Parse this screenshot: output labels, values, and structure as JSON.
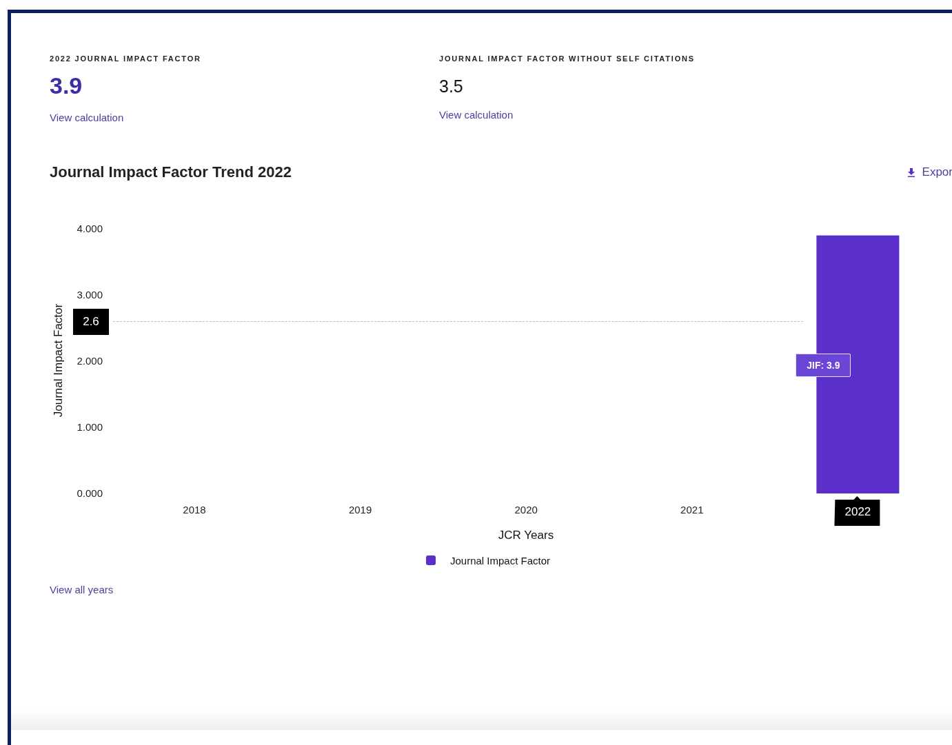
{
  "metrics": [
    {
      "label": "2022 JOURNAL IMPACT FACTOR",
      "value": "3.9",
      "link": "View calculation",
      "highlight": true
    },
    {
      "label": "JOURNAL IMPACT FACTOR WITHOUT SELF CITATIONS",
      "value": "3.5",
      "link": "View calculation",
      "highlight": false
    }
  ],
  "trend": {
    "title": "Journal Impact Factor Trend 2022",
    "export": "Expor",
    "chart_data": {
      "type": "bar",
      "xlabel": "JCR Years",
      "ylabel": "Journal Impact Factor",
      "categories": [
        "2018",
        "2019",
        "2020",
        "2021",
        "2022"
      ],
      "series": [
        {
          "name": "Journal Impact Factor",
          "color": "#5b2fc9",
          "values": [
            null,
            null,
            null,
            null,
            3.9
          ]
        }
      ],
      "ylim": [
        0,
        4
      ],
      "yticks": [
        {
          "value": 0,
          "label": "0.000"
        },
        {
          "value": 1,
          "label": "1.000"
        },
        {
          "value": 2,
          "label": "2.000"
        },
        {
          "value": 3,
          "label": "3.000"
        },
        {
          "value": 4,
          "label": "4.000"
        }
      ]
    },
    "average_label": "2.6",
    "selected_years": [
      false,
      false,
      false,
      false,
      true
    ],
    "tooltip": "JIF: 3.9"
  },
  "footer_link": "View all years"
}
